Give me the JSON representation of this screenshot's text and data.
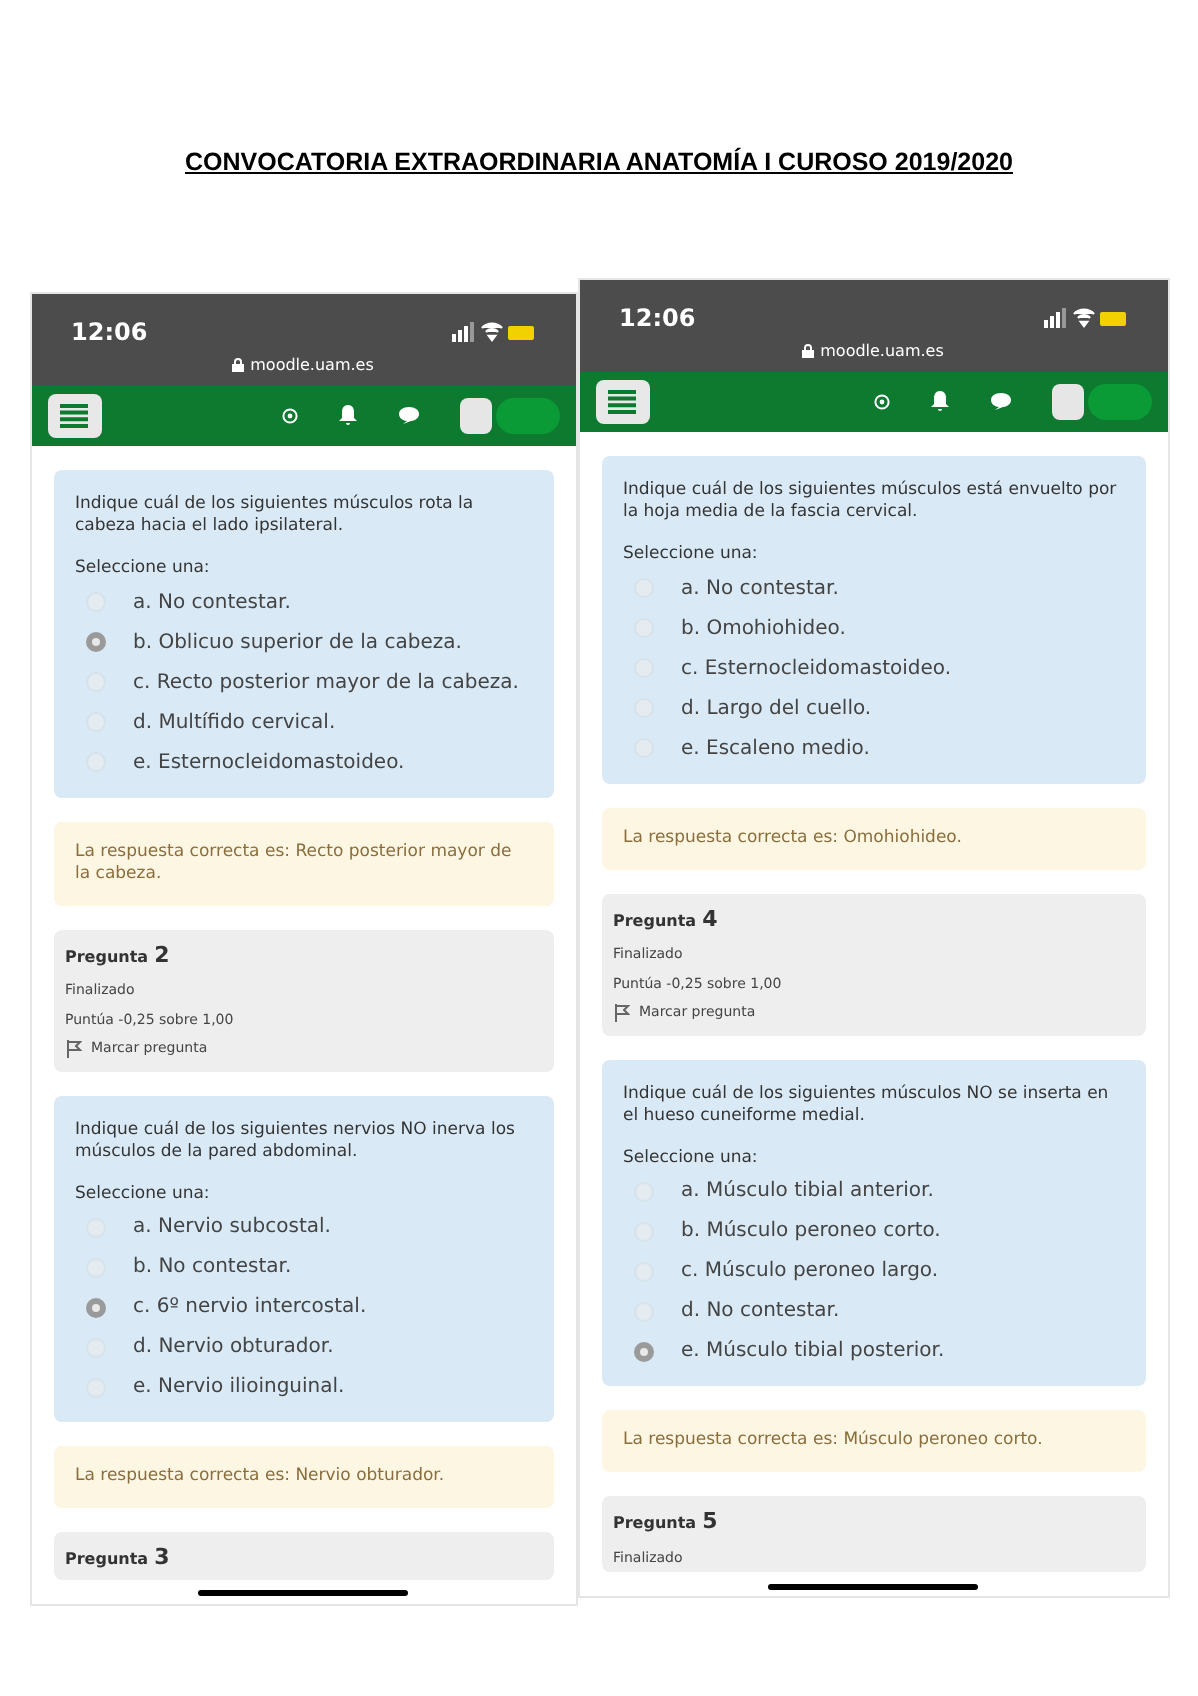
{
  "title": "CONVOCATORIA EXTRAORDINARIA ANATOMÍA I CUROSO 2019/2020",
  "screenshots": [
    {
      "time": "12:06",
      "url": "moodle.uam.es",
      "blocks": [
        {
          "kind": "question",
          "prompt": "Indique cuál de los siguientes músculos rota la cabeza hacia el lado ipsilateral.",
          "select_label": "Seleccione una:",
          "options": [
            {
              "text": "a. No contestar.",
              "selected": false
            },
            {
              "text": "b. Oblicuo superior de la cabeza.",
              "selected": true
            },
            {
              "text": "c. Recto posterior mayor de la cabeza.",
              "selected": false
            },
            {
              "text": "d. Multífido cervical.",
              "selected": false
            },
            {
              "text": "e. Esternocleidomastoideo.",
              "selected": false
            }
          ]
        },
        {
          "kind": "feedback",
          "text": "La respuesta correcta es: Recto posterior mayor de la cabeza."
        },
        {
          "kind": "info",
          "label": "Pregunta",
          "number": "2",
          "status": "Finalizado",
          "score": "Puntúa -0,25 sobre 1,00",
          "flag": "Marcar pregunta"
        },
        {
          "kind": "question",
          "prompt": "Indique cuál de los siguientes nervios NO inerva los músculos de la pared abdominal.",
          "select_label": "Seleccione una:",
          "options": [
            {
              "text": "a. Nervio subcostal.",
              "selected": false
            },
            {
              "text": "b. No contestar.",
              "selected": false
            },
            {
              "text": "c. 6º nervio intercostal.",
              "selected": true
            },
            {
              "text": "d. Nervio obturador.",
              "selected": false
            },
            {
              "text": "e. Nervio ilioinguinal.",
              "selected": false
            }
          ]
        },
        {
          "kind": "feedback",
          "text": "La respuesta correcta es: Nervio obturador."
        },
        {
          "kind": "info",
          "label": "Pregunta",
          "number": "3"
        }
      ]
    },
    {
      "time": "12:06",
      "url": "moodle.uam.es",
      "blocks": [
        {
          "kind": "question",
          "prompt": "Indique cuál de los siguientes músculos está envuelto por la hoja media de la fascia cervical.",
          "select_label": "Seleccione una:",
          "options": [
            {
              "text": "a. No contestar.",
              "selected": false
            },
            {
              "text": "b. Omohiohideo.",
              "selected": false
            },
            {
              "text": "c. Esternocleidomastoideo.",
              "selected": false
            },
            {
              "text": "d. Largo del cuello.",
              "selected": false
            },
            {
              "text": "e. Escaleno medio.",
              "selected": false
            }
          ]
        },
        {
          "kind": "feedback",
          "text": "La respuesta correcta es: Omohiohideo."
        },
        {
          "kind": "info",
          "label": "Pregunta",
          "number": "4",
          "status": "Finalizado",
          "score": "Puntúa -0,25 sobre 1,00",
          "flag": "Marcar pregunta"
        },
        {
          "kind": "question",
          "prompt": "Indique cuál de los siguientes músculos NO se inserta en el hueso cuneiforme medial.",
          "select_label": "Seleccione una:",
          "options": [
            {
              "text": "a. Músculo tibial anterior.",
              "selected": false
            },
            {
              "text": "b. Músculo peroneo corto.",
              "selected": false
            },
            {
              "text": "c. Músculo peroneo largo.",
              "selected": false
            },
            {
              "text": "d. No contestar.",
              "selected": false
            },
            {
              "text": "e. Músculo tibial posterior.",
              "selected": true
            }
          ]
        },
        {
          "kind": "feedback",
          "text": "La respuesta correcta es: Músculo peroneo corto."
        },
        {
          "kind": "info",
          "label": "Pregunta",
          "number": "5",
          "status": "Finalizado"
        }
      ]
    }
  ]
}
